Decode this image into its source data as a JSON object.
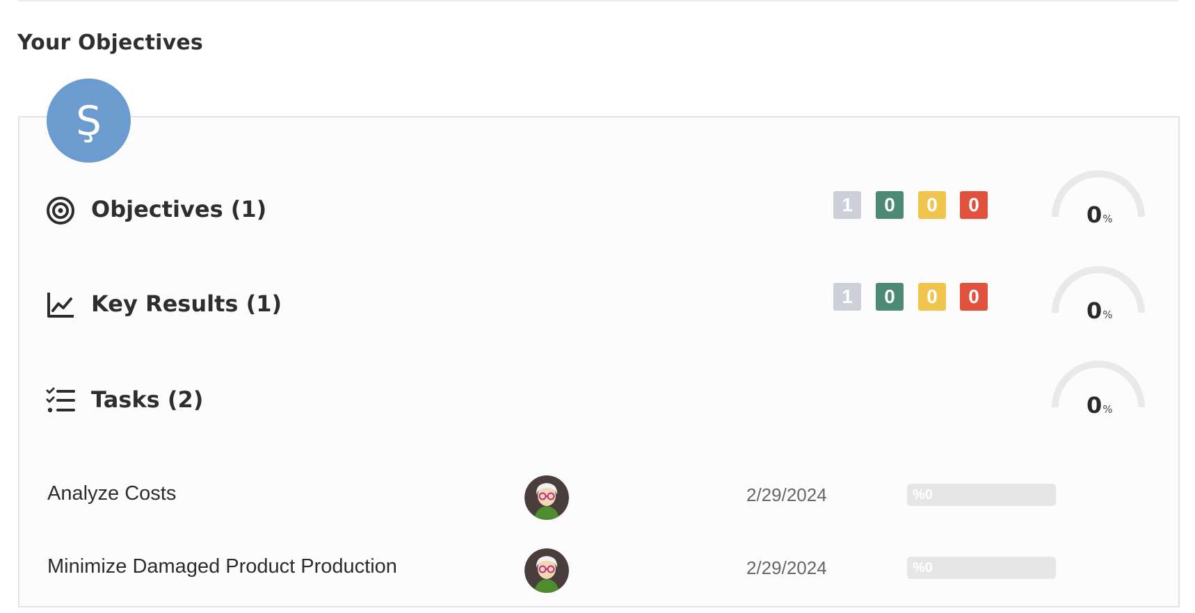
{
  "section_title": "Your Objectives",
  "owner": {
    "initial": "Ş",
    "color": "#6b9bcf"
  },
  "status_colors": {
    "not_started": "#cdd0d8",
    "on_track": "#4c8a74",
    "at_risk": "#efc54d",
    "behind": "#e0523d"
  },
  "rows": [
    {
      "label": "Objectives (1)",
      "icon": "target-icon",
      "counts": [
        "1",
        "0",
        "0",
        "0"
      ],
      "progress_value": "0",
      "progress_unit": "%",
      "progress_fraction": 0
    },
    {
      "label": "Key Results (1)",
      "icon": "line-chart-icon",
      "counts": [
        "1",
        "0",
        "0",
        "0"
      ],
      "progress_value": "0",
      "progress_unit": "%",
      "progress_fraction": 0
    },
    {
      "label": "Tasks (2)",
      "icon": "checklist-icon",
      "progress_value": "0",
      "progress_unit": "%",
      "progress_fraction": 0
    }
  ],
  "tasks": [
    {
      "name": "Analyze Costs",
      "due_date": "2/29/2024",
      "progress_label": "%0",
      "progress_fraction": 0
    },
    {
      "name": "Minimize Damaged Product Production",
      "due_date": "2/29/2024",
      "progress_label": "%0",
      "progress_fraction": 0
    }
  ]
}
